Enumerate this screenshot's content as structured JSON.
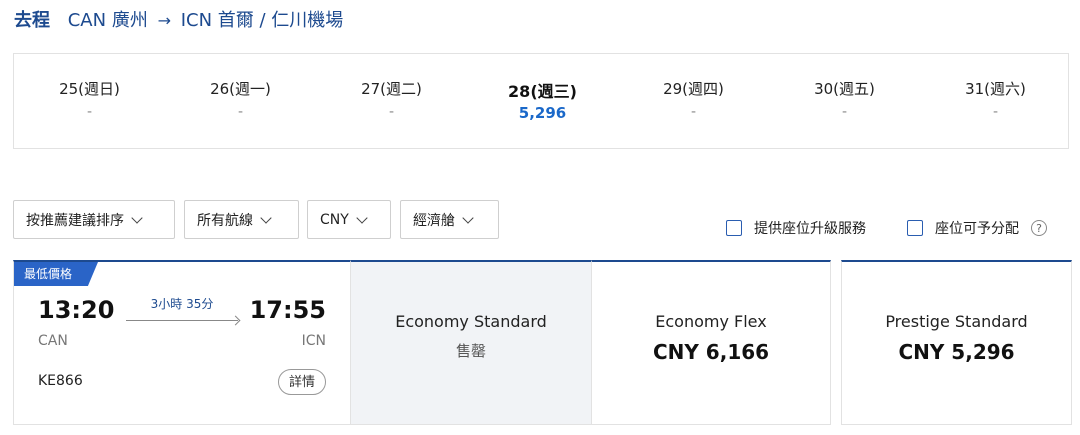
{
  "route": {
    "label": "去程",
    "origin_code": "CAN",
    "origin_city": "廣州",
    "arrow": "→",
    "dest_code": "ICN",
    "dest_city": "首爾 / 仁川機場"
  },
  "dates": [
    {
      "date": "25(週日)",
      "price": "-"
    },
    {
      "date": "26(週一)",
      "price": "-"
    },
    {
      "date": "27(週二)",
      "price": "-"
    },
    {
      "date": "28(週三)",
      "price": "5,296",
      "selected": true
    },
    {
      "date": "29(週四)",
      "price": "-"
    },
    {
      "date": "30(週五)",
      "price": "-"
    },
    {
      "date": "31(週六)",
      "price": "-"
    }
  ],
  "filters": {
    "sort": "按推薦建議排序",
    "routes": "所有航線",
    "currency": "CNY",
    "cabin": "經濟艙"
  },
  "options": {
    "upgrade": "提供座位升級服務",
    "seat_assign": "座位可予分配",
    "help": "?"
  },
  "flight": {
    "badge": "最低價格",
    "dep_time": "13:20",
    "arr_time": "17:55",
    "duration": "3小時 35分",
    "dep_code": "CAN",
    "arr_code": "ICN",
    "flight_no": "KE866",
    "detail": "詳情"
  },
  "fares": [
    {
      "name": "Economy Standard",
      "status": "售罄"
    },
    {
      "name": "Economy Flex",
      "price": "CNY 6,166"
    },
    {
      "name": "Prestige Standard",
      "price": "CNY 5,296"
    }
  ],
  "colors": {
    "brand_blue": "#1d4a8f",
    "accent_blue": "#2a64c7",
    "price_blue": "#1a68c9"
  }
}
